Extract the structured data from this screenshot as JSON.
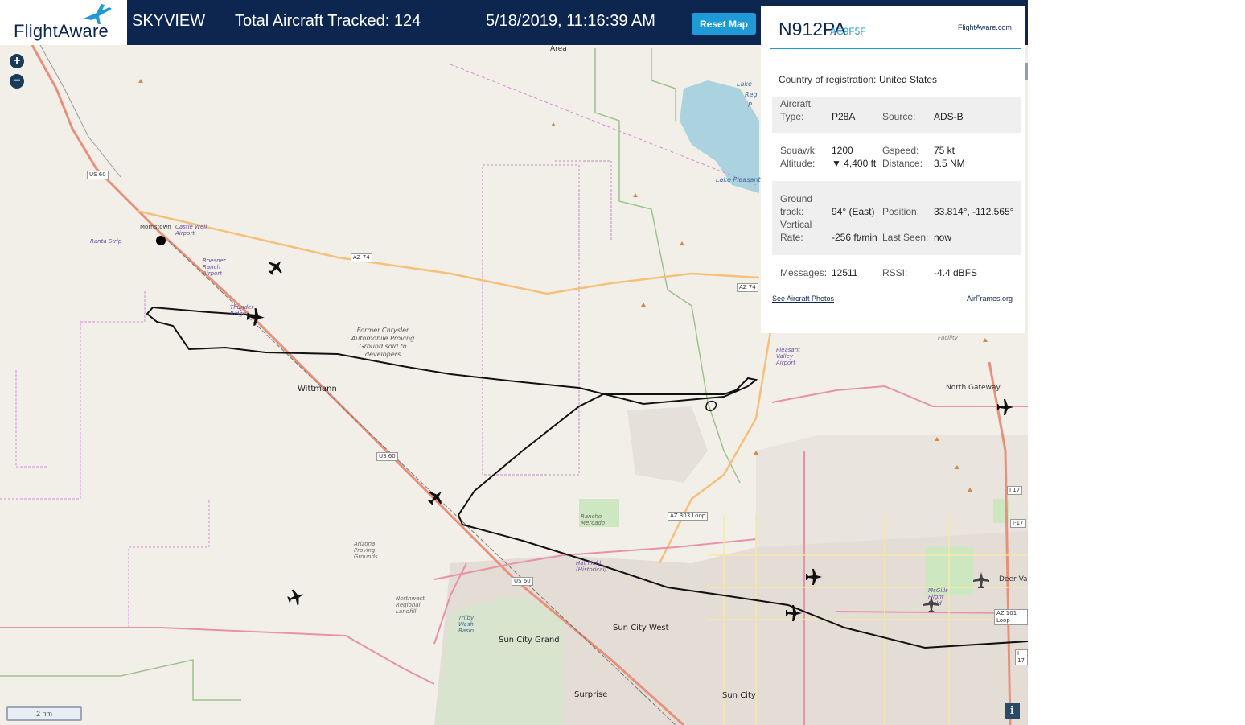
{
  "header": {
    "logo_text": "FlightAware",
    "app_name": "SKYVIEW",
    "total_tracked": "Total Aircraft Tracked: 124",
    "datetime": "5/18/2019, 11:16:39 AM",
    "reset_label": "Reset Map"
  },
  "map": {
    "labels": {
      "area": "Area",
      "lake_pleasant_1": "Lake",
      "lake_pleasant_2": "Reg",
      "lake_pleasant_3": "P",
      "lake_pleasant_inner": "Lake Pleasant",
      "morristown": "Morristown",
      "wittmann": "Wittmann",
      "north_gateway": "North Gateway",
      "sun_city_grand": "Sun City Grand",
      "sun_city_west": "Sun City West",
      "surprise": "Surprise",
      "sun_city": "Sun City",
      "deer_valley": "Deer Valle",
      "former_chrysler": "Former Chrysler Automobile Proving Ground sold to developers",
      "castle_well": "Castle Well Airport",
      "ranta_strip": "Ranta Strip",
      "roesner_ranch": "Roesner Ranch Airport",
      "thunder_ridge": "Thunder Ridge",
      "pleasant_valley": "Pleasant Valley Airport",
      "facility": "Facility",
      "rancho_mercado": "Rancho Mercado",
      "arizona_proving": "Arizona Proving Grounds",
      "nw_landfill": "Northwest Regional Landfill",
      "trilby": "Trilby Wash Basin",
      "mcgills": "McGills Flight Field",
      "hat_field": "Hat Field (Historical)"
    },
    "shields": {
      "us60_a": "US 60",
      "us60_b": "US 60",
      "us60_c": "US 60",
      "az74_a": "AZ 74",
      "az74_b": "AZ 74",
      "az303": "AZ 303 Loop",
      "az101": "AZ 101 Loop",
      "i17_a": "I 17",
      "i17_b": "I-17",
      "i17_c": "I 17"
    },
    "scale_label": "2 nm",
    "zoom_in": "+",
    "zoom_out": "−",
    "info": "i"
  },
  "panel": {
    "registration": "N912PA",
    "hex": "AC9F5F",
    "flightaware_link": "FlightAware.com",
    "country_label": "Country of registration:",
    "country_value": "United States",
    "aircraft_type_label_1": "Aircraft",
    "aircraft_type_label_2": "Type:",
    "aircraft_type": "P28A",
    "source_label": "Source:",
    "source": "ADS-B",
    "squawk_label": "Squawk:",
    "squawk": "1200",
    "gspeed_label": "Gspeed:",
    "gspeed": "75 kt",
    "altitude_label": "Altitude:",
    "altitude": "▼ 4,400 ft",
    "distance_label": "Distance:",
    "distance": "3.5 NM",
    "ground_track_label_1": "Ground",
    "ground_track_label_2": "track:",
    "ground_track": "94° (East)",
    "position_label": "Position:",
    "position": "33.814°, -112.565°",
    "vrate_label_1": "Vertical",
    "vrate_label_2": "Rate:",
    "vrate": "-256 ft/min",
    "last_seen_label": "Last Seen:",
    "last_seen": "now",
    "messages_label": "Messages:",
    "messages": "12511",
    "rssi_label": "RSSI:",
    "rssi": "-4.4 dBFS",
    "photos_link": "See Aircraft Photos",
    "airframes_link": "AirFrames.org"
  },
  "colors": {
    "header_bg": "#0d2650",
    "accent": "#1e9ad7",
    "map_bg": "#f2efe9"
  }
}
